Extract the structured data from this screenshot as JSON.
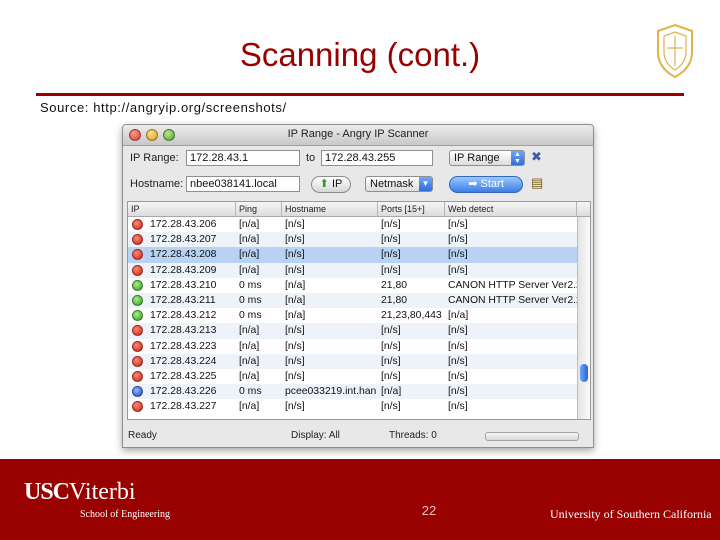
{
  "slide": {
    "title": "Scanning (cont.)",
    "source": "Source: http://angryip.org/screenshots/",
    "slide_number": "22"
  },
  "footer": {
    "logo_primary": "USC",
    "logo_secondary": "Viterbi",
    "school": "School of Engineering",
    "university": "University of Southern California"
  },
  "window": {
    "title": "IP Range - Angry IP Scanner"
  },
  "toolbar": {
    "ip_range_label": "IP Range:",
    "ip_start": "172.28.43.1",
    "to_label": "to",
    "ip_end": "172.28.43.255",
    "feeder_select": "IP Range",
    "hostname_label": "Hostname:",
    "hostname_value": "nbee038141.local",
    "ip_button": "IP",
    "netmask_select": "Netmask",
    "start_button": "Start"
  },
  "table": {
    "columns": [
      "IP",
      "Ping",
      "Hostname",
      "Ports [15+]",
      "Web detect"
    ],
    "rows": [
      {
        "status": "red",
        "ip": "172.28.43.206",
        "ping": "[n/a]",
        "hostname": "[n/s]",
        "ports": "[n/s]",
        "web": "[n/s]"
      },
      {
        "status": "red",
        "ip": "172.28.43.207",
        "ping": "[n/a]",
        "hostname": "[n/s]",
        "ports": "[n/s]",
        "web": "[n/s]"
      },
      {
        "status": "red",
        "ip": "172.28.43.208",
        "ping": "[n/a]",
        "hostname": "[n/s]",
        "ports": "[n/s]",
        "web": "[n/s]"
      },
      {
        "status": "red",
        "ip": "172.28.43.209",
        "ping": "[n/a]",
        "hostname": "[n/s]",
        "ports": "[n/s]",
        "web": "[n/s]"
      },
      {
        "status": "green",
        "ip": "172.28.43.210",
        "ping": "0 ms",
        "hostname": "[n/a]",
        "ports": "21,80",
        "web": "CANON HTTP Server Ver2.2"
      },
      {
        "status": "green",
        "ip": "172.28.43.211",
        "ping": "0 ms",
        "hostname": "[n/a]",
        "ports": "21,80",
        "web": "CANON HTTP Server Ver2.2"
      },
      {
        "status": "green",
        "ip": "172.28.43.212",
        "ping": "0 ms",
        "hostname": "[n/a]",
        "ports": "21,23,80,443",
        "web": "[n/a]"
      },
      {
        "status": "red",
        "ip": "172.28.43.213",
        "ping": "[n/a]",
        "hostname": "[n/s]",
        "ports": "[n/s]",
        "web": "[n/s]"
      },
      {
        "status": "red",
        "ip": "172.28.43.223",
        "ping": "[n/a]",
        "hostname": "[n/s]",
        "ports": "[n/s]",
        "web": "[n/s]"
      },
      {
        "status": "red",
        "ip": "172.28.43.224",
        "ping": "[n/a]",
        "hostname": "[n/s]",
        "ports": "[n/s]",
        "web": "[n/s]"
      },
      {
        "status": "red",
        "ip": "172.28.43.225",
        "ping": "[n/a]",
        "hostname": "[n/s]",
        "ports": "[n/s]",
        "web": "[n/s]"
      },
      {
        "status": "blue",
        "ip": "172.28.43.226",
        "ping": "0 ms",
        "hostname": "pcee033219.int.han",
        "ports": "[n/a]",
        "web": "[n/s]"
      },
      {
        "status": "red",
        "ip": "172.28.43.227",
        "ping": "[n/a]",
        "hostname": "[n/s]",
        "ports": "[n/s]",
        "web": "[n/s]"
      }
    ],
    "selected_row_index": 2
  },
  "statusbar": {
    "state": "Ready",
    "display": "Display: All",
    "threads": "Threads: 0"
  },
  "colors": {
    "accent": "#990000",
    "selection": "#b7d2f3"
  }
}
